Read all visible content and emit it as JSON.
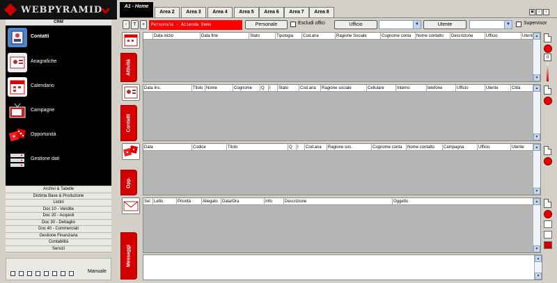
{
  "app": {
    "logo_text": "WEBPYRAMID",
    "section": "CRM",
    "colors": {
      "brand_red": "#d50000",
      "filter_red": "#ff0000",
      "menu_bg": "#000000"
    }
  },
  "sidebar": {
    "items": [
      {
        "label": "Contatti",
        "icon": "contacts-icon",
        "active": true
      },
      {
        "label": "Anagrafiche",
        "icon": "id-card-icon",
        "active": false
      },
      {
        "label": "Calendario",
        "icon": "calendar-icon",
        "active": false
      },
      {
        "label": "Campagne",
        "icon": "tv-icon",
        "active": false
      },
      {
        "label": "Opportunità",
        "icon": "dice-icon",
        "active": false
      },
      {
        "label": "Gestione dati",
        "icon": "server-icon",
        "active": false
      }
    ],
    "modules": [
      "Archivi & Tabelle",
      "Distinta Base & Produzione",
      "Listini",
      "Doc 10 - Vendite",
      "Doc 20 - Acquisti",
      "Doc 30 - Dettaglio",
      "Doc 40 - Commerciali",
      "Gestione Finanziaria",
      "Contabilità",
      "Servizi"
    ],
    "manual_label": "Manuale"
  },
  "tabs": [
    "A1 - Home",
    "Area 2",
    "Area 3",
    "Area 4",
    "Area 5",
    "Area 6",
    "Area 7",
    "Area 8"
  ],
  "toolbar": {
    "btn_minus": "-",
    "btn_t": "T",
    "btn_plus": "+",
    "filter_text": "Personale - Azienda Demo",
    "personale_btn": "Personale",
    "escludi_label": "Escludi uffici",
    "ufficio_btn": "Ufficio",
    "utente_btn": "Utente",
    "supervisor_label": "Supervisor"
  },
  "panels": [
    {
      "label": "Attività",
      "icon": "calendar-icon",
      "columns": [
        "",
        "Data inizio",
        "Data fine",
        "Stato",
        "Tipologia",
        "Cod.ana",
        "Ragione Sociale",
        "Cognome conta",
        "Nome contatto",
        "Descrizione",
        "Ufficio",
        "Utente"
      ]
    },
    {
      "label": "Contatti",
      "icon": "contacts-icon",
      "columns": [
        "Data Ins.",
        "Titolo",
        "Nome",
        "Cognome",
        "Q",
        "I",
        "Stato",
        "Cod.ana",
        "Ragione sociale",
        "Cellulare",
        "Interno",
        "telefono",
        "Ufficio",
        "Utente",
        "Città"
      ]
    },
    {
      "label": "Opp.",
      "icon": "dice-icon",
      "columns": [
        "Data",
        "Codice",
        "Titolo",
        "Q",
        "I",
        "Cod.ana",
        "Ragione soc.",
        "Cognome conta",
        "Nome contatto",
        "Campagna",
        "Ufficio",
        "Utente"
      ]
    },
    {
      "label": "Messaggi",
      "icon": "envelope-icon",
      "columns": [
        "Sel",
        "Letto",
        "Priorità",
        "Allegato",
        "Data/Ora",
        "Info",
        "Descrizione",
        "Oggetto"
      ]
    }
  ],
  "zoom_value": "0",
  "window_buttons": [
    "▣",
    "‹",
    "›"
  ]
}
